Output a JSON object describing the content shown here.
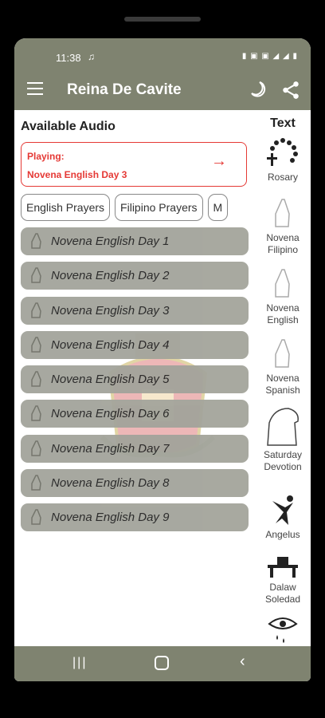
{
  "status": {
    "time": "11:38",
    "music_icon": "music-note-icon",
    "right_icons": "▮ ▣ ▣ ◢ ◢ ▮"
  },
  "appbar": {
    "title": "Reina De Cavite"
  },
  "main": {
    "heading": "Available Audio",
    "now_playing": {
      "label": "Playing:",
      "track": "Novena English Day 3",
      "accent": "#e53935"
    },
    "chips": [
      "English Prayers",
      "Filipino Prayers",
      "M"
    ],
    "items": [
      "Novena English Day 1",
      "Novena English Day 2",
      "Novena English Day 3",
      "Novena English Day 4",
      "Novena English Day 5",
      "Novena English Day 6",
      "Novena English Day 7",
      "Novena English Day 8",
      "Novena English Day 9"
    ]
  },
  "side": {
    "title": "Text",
    "items": [
      {
        "label": "Rosary",
        "icon": "rosary-icon"
      },
      {
        "label": "Novena\nFilipino",
        "icon": "praying-hands-icon"
      },
      {
        "label": "Novena\nEnglish",
        "icon": "praying-hands-icon"
      },
      {
        "label": "Novena\nSpanish",
        "icon": "praying-hands-icon"
      },
      {
        "label": "Saturday\nDevotion",
        "icon": "saturday-devotion-icon"
      },
      {
        "label": "Angelus",
        "icon": "angelus-icon"
      },
      {
        "label": "Dalaw\nSoledad",
        "icon": "dalaw-icon"
      }
    ]
  },
  "theme": {
    "bar_color": "#7f8370",
    "item_color": "#a3a49b"
  }
}
